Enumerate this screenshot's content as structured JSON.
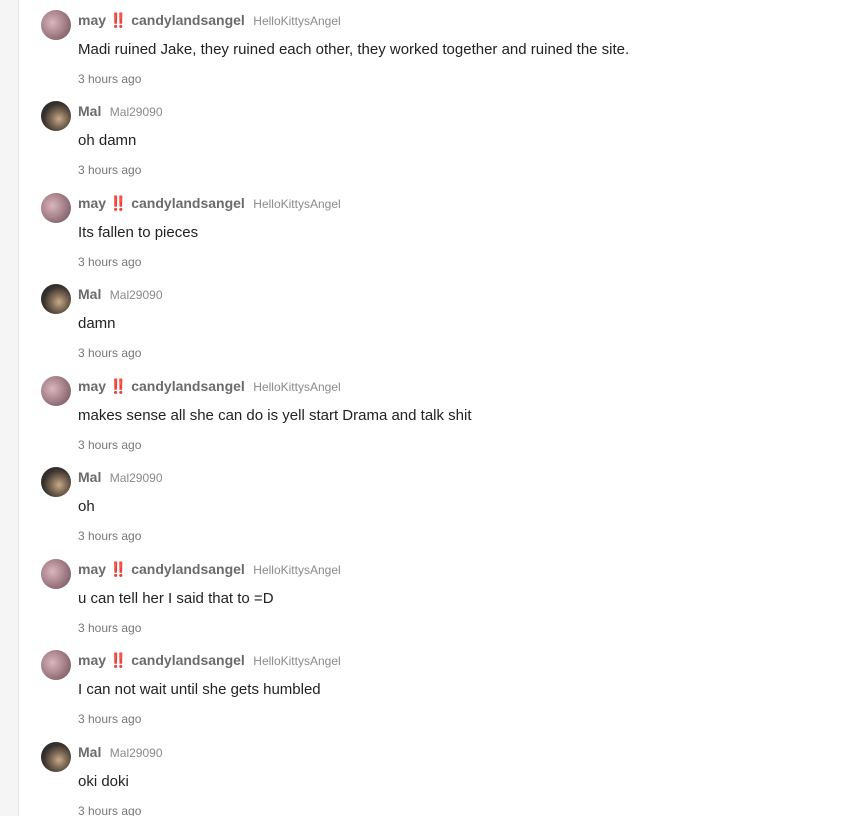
{
  "messages": [
    {
      "user": "may ‼️ candylandsangel",
      "handle": "HelloKittysAngel",
      "text": "Madi ruined Jake, they ruined each other, they worked together and ruined the site.",
      "time": "3 hours ago",
      "avatar": "may-avatar"
    },
    {
      "user": "Mal",
      "handle": "Mal29090",
      "text": "oh damn",
      "time": "3 hours ago",
      "avatar": "mal-avatar"
    },
    {
      "user": "may ‼️ candylandsangel",
      "handle": "HelloKittysAngel",
      "text": "Its fallen to pieces",
      "time": "3 hours ago",
      "avatar": "may-avatar"
    },
    {
      "user": "Mal",
      "handle": "Mal29090",
      "text": "damn",
      "time": "3 hours ago",
      "avatar": "mal-avatar"
    },
    {
      "user": "may ‼️ candylandsangel",
      "handle": "HelloKittysAngel",
      "text": "makes sense all she can do is yell start Drama and talk shit",
      "time": "3 hours ago",
      "avatar": "may-avatar"
    },
    {
      "user": "Mal",
      "handle": "Mal29090",
      "text": "oh",
      "time": "3 hours ago",
      "avatar": "mal-avatar"
    },
    {
      "user": "may ‼️ candylandsangel",
      "handle": "HelloKittysAngel",
      "text": "u can tell her I said that to =D",
      "time": "3 hours ago",
      "avatar": "may-avatar"
    },
    {
      "user": "may ‼️ candylandsangel",
      "handle": "HelloKittysAngel",
      "text": "I can not wait until she gets humbled",
      "time": "3 hours ago",
      "avatar": "may-avatar"
    },
    {
      "user": "Mal",
      "handle": "Mal29090",
      "text": "oki doki",
      "time": "3 hours ago",
      "avatar": "mal-avatar"
    }
  ]
}
